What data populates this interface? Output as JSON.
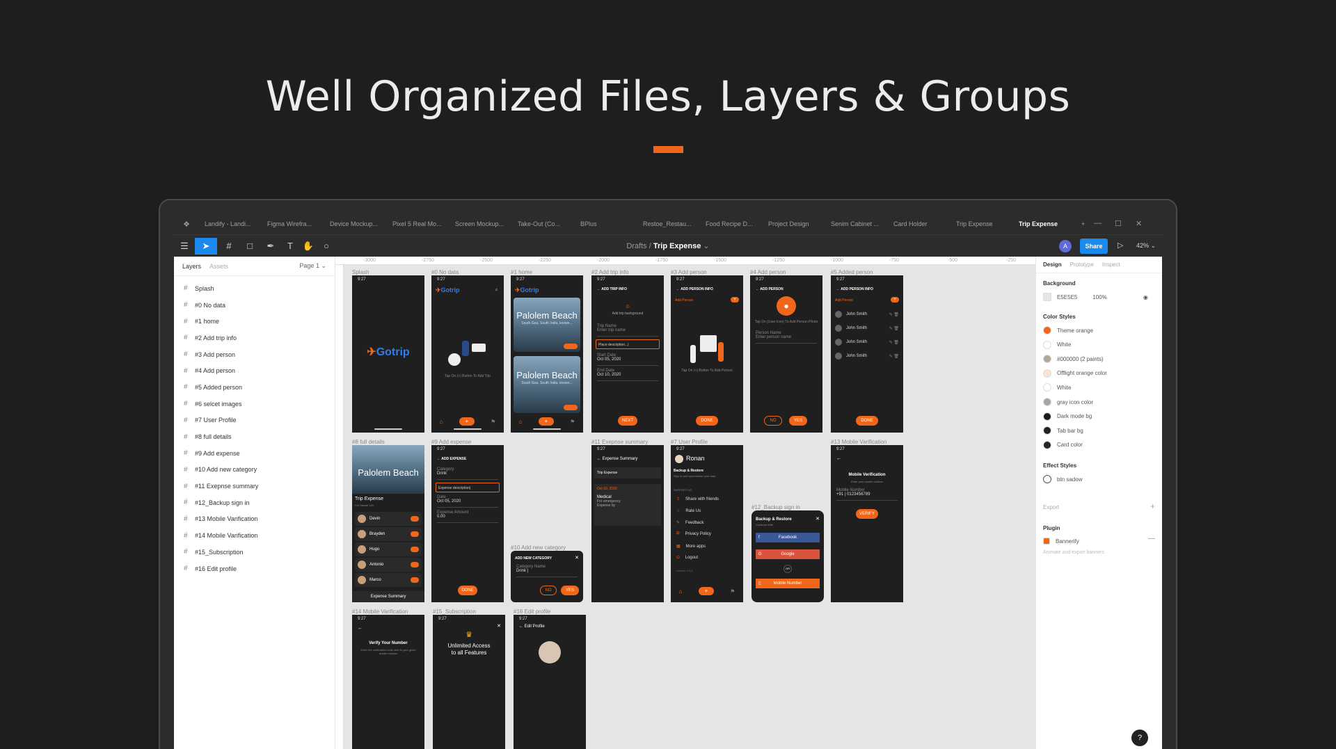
{
  "hero": {
    "title": "Well Organized Files, Layers & Groups"
  },
  "tabs": [
    "Landify - Landi...",
    "Figma Wirefra...",
    "Device Mockup...",
    "Pixel 5 Real Mo...",
    "Screen Mockup...",
    "Take-Out (Co...",
    "BPlus",
    "Restoe_Restau...",
    "Food Recipe D...",
    "Project Design",
    "Senim Cabinet ...",
    "Card Holder",
    "Trip Expense",
    "Trip Expense"
  ],
  "active_tab_index": 13,
  "toolbar": {
    "crumb_root": "Drafts",
    "crumb_sep": "/",
    "file_name": "Trip Expense",
    "share": "Share",
    "zoom": "42%",
    "avatar_initial": "A"
  },
  "layers_panel": {
    "tab_layers": "Layers",
    "tab_assets": "Assets",
    "page": "Page 1",
    "items": [
      "Splash",
      "#0 No data",
      "#1 home",
      "#2 Add trip info",
      "#3 Add person",
      "#4 Add person",
      "#5 Added person",
      "#6 selcet images",
      "#7 User Profile",
      "#8 full details",
      "#9 Add expense",
      "#10 Add new category",
      "#11 Exepnse summary",
      "#12_Backup sign in",
      "#13 Mobile Varification",
      "#14 Mobile Varification",
      "#15_Subscription",
      "#16 Edit profile"
    ]
  },
  "ruler": [
    "-3000",
    "-2750",
    "-2500",
    "-2250",
    "-2000",
    "-1750",
    "-1500",
    "-1250",
    "-1000",
    "-750",
    "-500",
    "-250"
  ],
  "frames": {
    "labels": [
      "Splash",
      "#0 No data",
      "#1 home",
      "#2 Add trip info",
      "#3 Add person",
      "#4 Add person",
      "#5 Added person",
      "#8 full details",
      "#9 Add expense",
      "#11 Exepnse summary",
      "#7 User Profile",
      "#13 Mobile Varification",
      "#10 Add new category",
      "#12_Backup sign in",
      "#14 Mobile Varification",
      "#15_Subscription",
      "#16 Edit profile"
    ],
    "status_time": "9:27",
    "brand": "Gotrip",
    "no_data_hint": "Tap On (+) Button To Add Trip",
    "beach_name": "Palolem Beach",
    "beach_sub": "South Goa, South India, known...",
    "add_trip_title": "ADD TRIP INFO",
    "add_trip_bg": "Add trip background",
    "trip_name_label": "Trip Name",
    "trip_name_ph": "Enter trip name",
    "desc_label": "Description",
    "desc_ph": "Place description...|",
    "start_label": "Start Date",
    "start_value": "Oct 05, 2020",
    "end_label": "End Date",
    "end_value": "Oct 10, 2020",
    "next": "NEXT",
    "add_person_info": "ADD PERSON INFO",
    "add_person_link": "Add Person",
    "add_person_hint": "Tap On (+) Button To Add Person",
    "done": "DONE",
    "add_person_title": "ADD PERSON",
    "user_icon_hint": "Tap On (User Icon) To Add Person Photo",
    "person_name_label": "Person Name",
    "person_name_ph": "Enter person name",
    "no": "NO",
    "yes": "YES",
    "people": [
      "John Smith",
      "John Smith",
      "John Smith",
      "John Smith"
    ],
    "full_details_title": "Trip Expense",
    "full_details_total": "For Hawaii 125",
    "expense_people": [
      "Devin",
      "Brayden",
      "Hugo",
      "Antonio",
      "Marco"
    ],
    "expense_summary_btn": "Expense Summary",
    "add_expense_title": "ADD EXPENSE",
    "category_label": "Category",
    "category_value": "Drink",
    "expense_desc_ph": "Expense description|",
    "date_label": "Date",
    "date_value": "Oct 05, 2020",
    "amount_label": "Expense Amount",
    "amount_value": "0.00",
    "summary_title": "Expense Summary",
    "summary_trip": "Trip Expense",
    "summary_date": "Oct 10, 2020",
    "summary_item": "Medical",
    "summary_item_sub": "For emergency",
    "summary_by": "Expense by",
    "profile_name": "Ronan",
    "backup_restore": "Backup & Restore",
    "backup_sub": "Sign in and synchronize your data",
    "support_us": "SUPPORT US",
    "profile_menu": [
      "Share with friends",
      "Rate Us",
      "Feedback",
      "Privacy Policy",
      "More apps",
      "Logout"
    ],
    "version": "Version 1.0.0",
    "mobile_verification": "Mobile Verification",
    "mobile_hint": "Enter your mobile number",
    "mobile_label": "Mobile Number",
    "mobile_value": "+91 | 0123456789",
    "verify": "VERIFY",
    "new_category_title": "ADD NEW CATEGORY",
    "new_category_label": "Category Name",
    "new_category_value": "Drink |",
    "backup_continue": "Continue With",
    "facebook": "Facebook",
    "google": "Google",
    "or": "OR",
    "mobile_number_btn": "Mobile Number",
    "verify_number": "Verify Your Number",
    "verify_number_sub": "Enter the verification code sent to your given mobile number",
    "unlimited": "Unlimited Access",
    "to_all": "to all Features",
    "edit_profile": "Edit Profile"
  },
  "design_panel": {
    "tabs": [
      "Design",
      "Prototype",
      "Inspect"
    ],
    "background_title": "Background",
    "bg_hex": "E5E5E5",
    "bg_opacity": "100%",
    "color_styles_title": "Color Styles",
    "color_styles": [
      {
        "name": "Theme orange",
        "color": "#f0661b"
      },
      {
        "name": "White",
        "color": "#ffffff"
      },
      {
        "name": "#000000 (2 paints)",
        "color": "#b3a69a"
      },
      {
        "name": "Offlight orange color",
        "color": "#fde3d3"
      },
      {
        "name": "White",
        "color": "#ffffff"
      },
      {
        "name": "gray icon color",
        "color": "#a6a6a6"
      },
      {
        "name": "Dark mode bg",
        "color": "#1a1a1a"
      },
      {
        "name": "Tab bar bg",
        "color": "#222222"
      },
      {
        "name": "Card color",
        "color": "#262626"
      }
    ],
    "effect_styles_title": "Effect Styles",
    "effect_name": "btn sadow",
    "export_title": "Export",
    "plugin_title": "Plugin",
    "plugin_name": "Bannerify",
    "plugin_desc": "Animate and export banners"
  }
}
